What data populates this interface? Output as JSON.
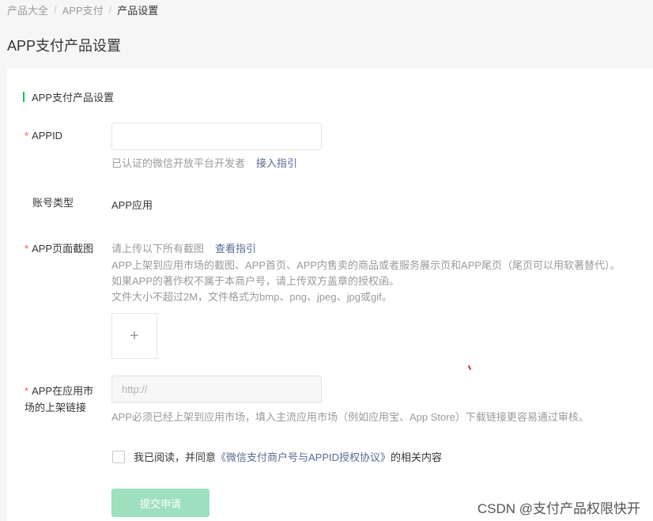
{
  "breadcrumb": {
    "items": [
      "产品大全",
      "APP支付",
      "产品设置"
    ],
    "separator": "/"
  },
  "page_title": "APP支付产品设置",
  "section_title": "APP支付产品设置",
  "accent_color": "#07c160",
  "form": {
    "required_mark": "*",
    "appid": {
      "label": "APPID",
      "value": "",
      "placeholder": "",
      "hint": "已认证的微信开放平台开发者",
      "hint_link": "接入指引"
    },
    "account_type": {
      "label": "账号类型",
      "value": "APP应用"
    },
    "screenshots": {
      "label": "APP页面截图",
      "intro": "请上传以下所有截图",
      "intro_link": "查看指引",
      "line1": "APP上架到应用市场的截图、APP首页、APP内售卖的商品或者服务展示页和APP尾页（尾页可以用软著替代）。",
      "line2": "如果APP的著作权不属于本商户号，请上传双方盖章的授权函。",
      "line3": "文件大小不超过2M，文件格式为bmp、png、jpeg、jpg或gif。",
      "upload_symbol": "+",
      "upload_icon": "plus-icon"
    },
    "market_link": {
      "label_line1": "APP在应用市",
      "label_line2": "场的上架链接",
      "value": "",
      "placeholder": "http://",
      "hint": "APP必须已经上架到应用市场，填入主流应用市场（例如应用宝、App Store）下载链接更容易通过审核。"
    },
    "agreement": {
      "checked": false,
      "prefix": "我已阅读，并同意",
      "link": "《微信支付商户号与APPID授权协议》",
      "suffix": "的相关内容"
    },
    "submit_label": "提交申请"
  },
  "watermark": "CSDN @支付产品权限快开"
}
